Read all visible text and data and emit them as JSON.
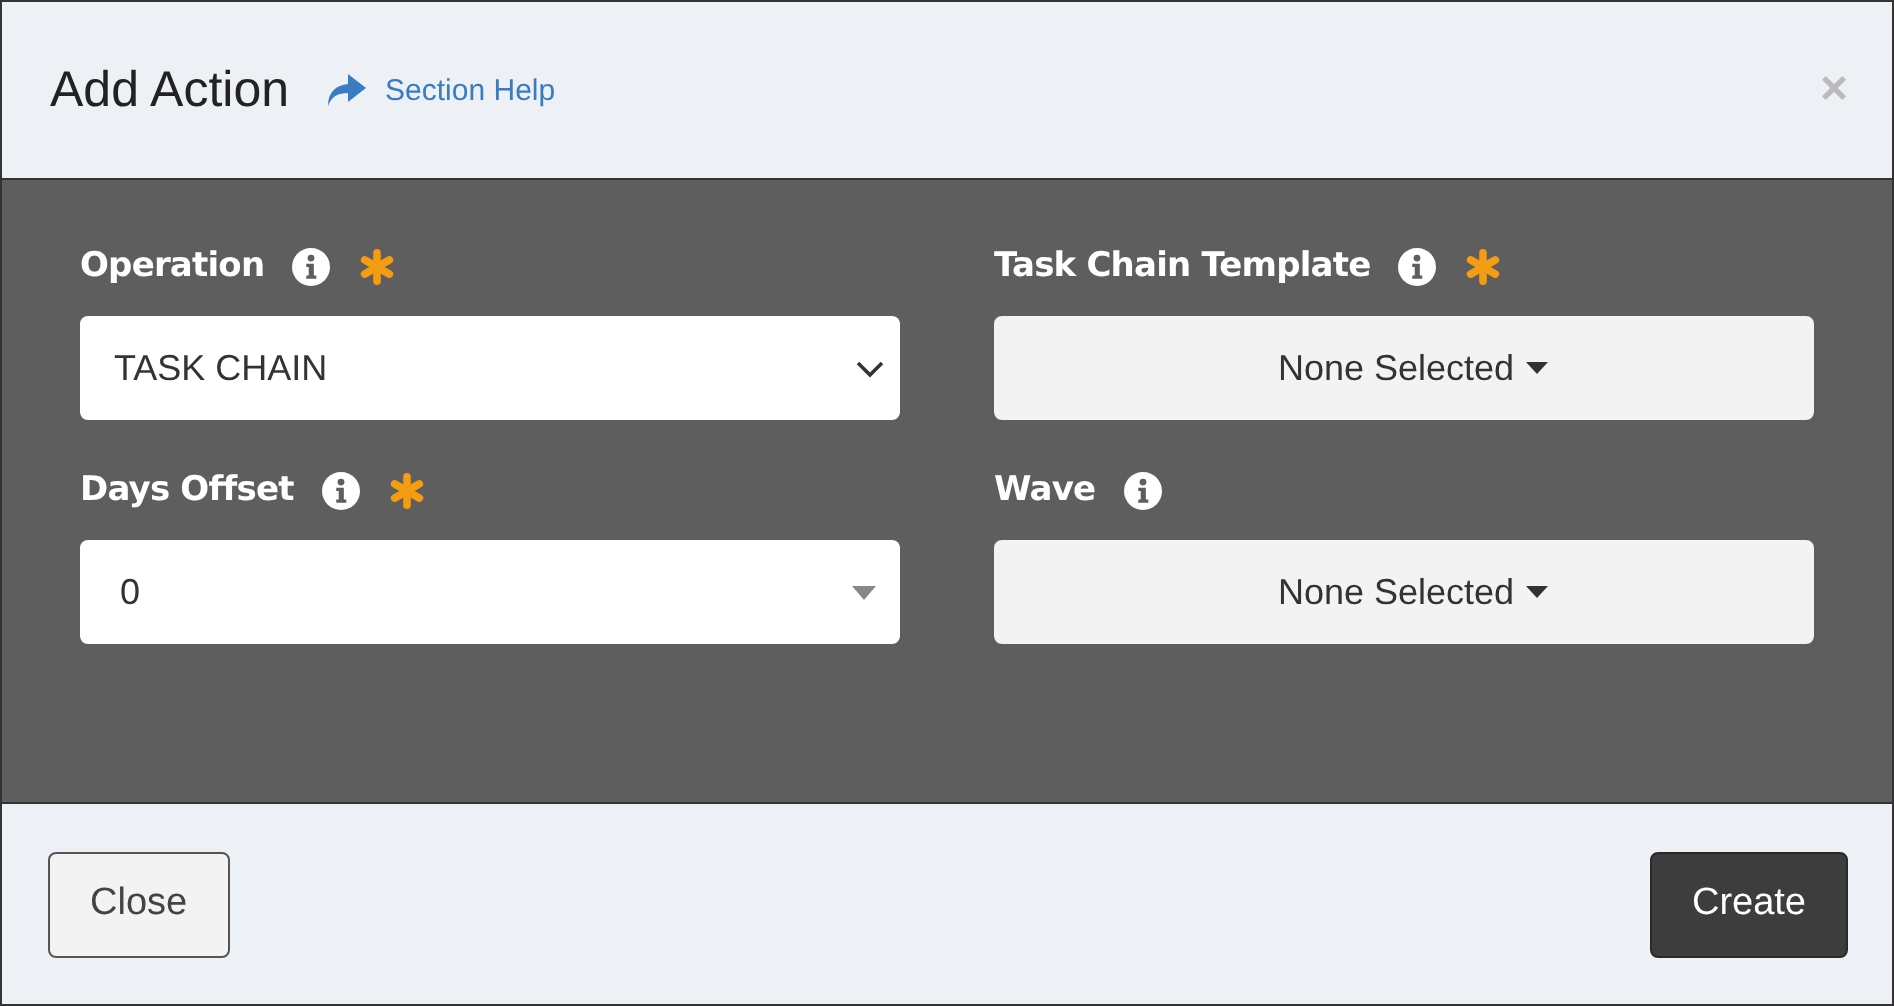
{
  "dialog": {
    "title": "Add Action",
    "help_link": "Section Help",
    "close_glyph": "×"
  },
  "fields": [
    {
      "label": "Operation",
      "required": true,
      "kind": "select",
      "value": "TASK CHAIN"
    },
    {
      "label": "Task Chain Template",
      "required": true,
      "kind": "multiselect",
      "value": "None Selected"
    },
    {
      "label": "Days Offset",
      "required": true,
      "kind": "combo",
      "value": "0"
    },
    {
      "label": "Wave",
      "required": false,
      "kind": "multiselect",
      "value": "None Selected"
    }
  ],
  "buttons": [
    {
      "label": "Close",
      "kind": "secondary"
    },
    {
      "label": "Create",
      "kind": "primary"
    }
  ]
}
